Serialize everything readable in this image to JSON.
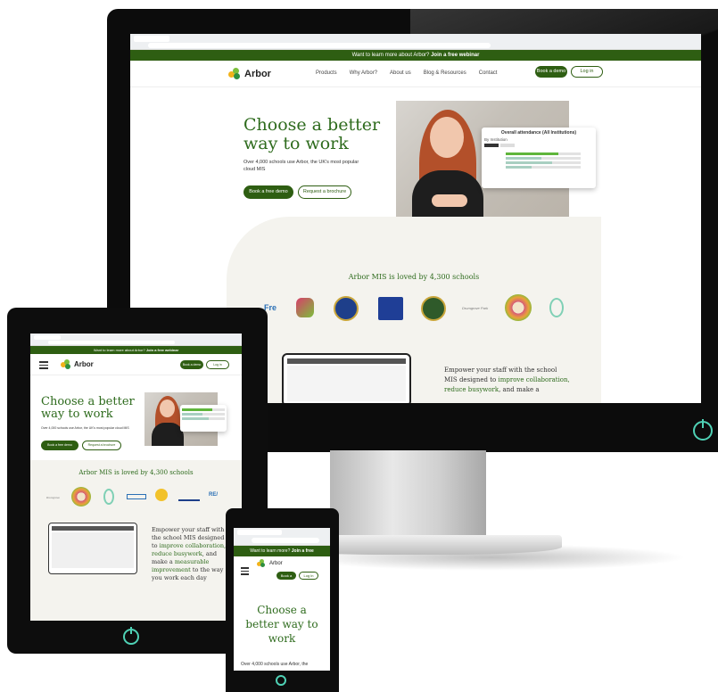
{
  "site": {
    "brand": "Arbor",
    "banner_text": "Want to learn more about Arbor?",
    "banner_link": "Join a free webinar",
    "nav": [
      "Products",
      "Why Arbor?",
      "About us",
      "Blog & Resources",
      "Contact"
    ],
    "book_demo": "Book a demo",
    "log_in": "Log in",
    "hero_title_line1": "Choose a better",
    "hero_title_line2": "way to work",
    "hero_sub": "Over 4,000 schools use Arbor, the UK's most popular cloud MIS",
    "cta_primary": "Book a free demo",
    "cta_secondary": "Request a brochure",
    "attendance_card_title": "Overall attendance (All Institutions)",
    "attendance_card_sub": "By Institution",
    "loved_title": "Arbor MIS is loved by 4,300 schools",
    "empower_1": "Empower your staff with the school",
    "empower_2": "MIS designed to",
    "empower_link1": "improve collaboration,",
    "empower_link2": "reduce busywork",
    "empower_3": ", and make a",
    "tablet_empower_1": "Empower your staff with",
    "tablet_empower_2": "the school MIS designed",
    "tablet_empower_3": "to",
    "tablet_link1": "improve collaboration,",
    "tablet_link2": "reduce busywork",
    "tablet_empower_4": ", and",
    "tablet_empower_5": "make a",
    "tablet_link3": "measurable",
    "tablet_link4": "improvement",
    "tablet_empower_6": "to the way",
    "tablet_empower_7": "you work each day",
    "phone_banner": "Want to learn more?",
    "phone_banner_link": "Join a free",
    "phone_book": "Book a",
    "phone_title_1": "Choose a",
    "phone_title_2": "better way to",
    "phone_title_3": "work",
    "phone_sub": "Over 4,000 schools use Arbor, the"
  },
  "colors": {
    "brand_green": "#2e5e12",
    "accent_teal": "#4fd1b5",
    "cream": "#f4f3ee"
  },
  "icons": [
    "power-icon",
    "hamburger-icon",
    "arbor-logo-icon"
  ]
}
